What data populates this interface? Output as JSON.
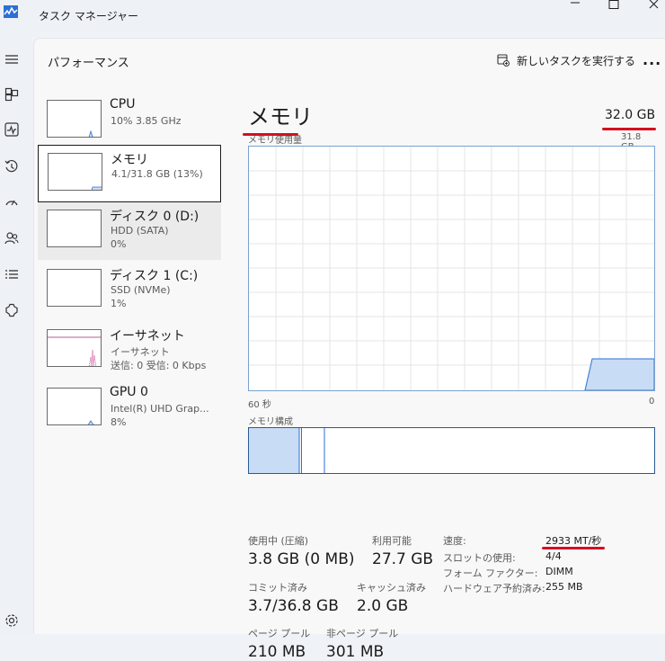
{
  "window": {
    "title": "タスク マネージャー"
  },
  "header": {
    "title": "パフォーマンス",
    "run_task_label": "新しいタスクを実行する",
    "more_label": "..."
  },
  "resources": [
    {
      "name": "CPU",
      "line1": "10%  3.85 GHz",
      "line2": ""
    },
    {
      "name": "メモリ",
      "line1": "4.1/31.8 GB (13%)",
      "line2": ""
    },
    {
      "name": "ディスク 0 (D:)",
      "line1": "HDD (SATA)",
      "line2": "0%"
    },
    {
      "name": "ディスク 1 (C:)",
      "line1": "SSD (NVMe)",
      "line2": "1%"
    },
    {
      "name": "イーサネット",
      "line1": "イーサネット",
      "line2": "送信: 0 受信: 0 Kbps"
    },
    {
      "name": "GPU 0",
      "line1": "Intel(R) UHD Grap...",
      "line2": "8%"
    }
  ],
  "detail": {
    "title": "メモリ",
    "capacity": "32.0 GB",
    "usage_label": "メモリ使用量",
    "usage_max": "31.8 GB",
    "time_left": "60 秒",
    "time_right": "0",
    "composition_label": "メモリ構成",
    "stats": {
      "in_use_label": "使用中 (圧縮)",
      "in_use": "3.8 GB (0 MB)",
      "available_label": "利用可能",
      "available": "27.7 GB",
      "committed_label": "コミット済み",
      "committed": "3.7/36.8 GB",
      "cached_label": "キャッシュ済み",
      "cached": "2.0 GB",
      "paged_label": "ページ プール",
      "paged": "210 MB",
      "nonpaged_label": "非ページ プール",
      "nonpaged": "301 MB"
    },
    "specs": [
      {
        "label": "速度:",
        "value": "2933 MT/秒"
      },
      {
        "label": "スロットの使用:",
        "value": "4/4"
      },
      {
        "label": "フォーム ファクター:",
        "value": "DIMM"
      },
      {
        "label": "ハードウェア予約済み:",
        "value": "255 MB"
      }
    ]
  },
  "colors": {
    "accent": "#d4101e",
    "graph_line": "#7aa1d1",
    "graph_fill": "#c9dcf5",
    "selected_border": "#1b1b1b"
  }
}
